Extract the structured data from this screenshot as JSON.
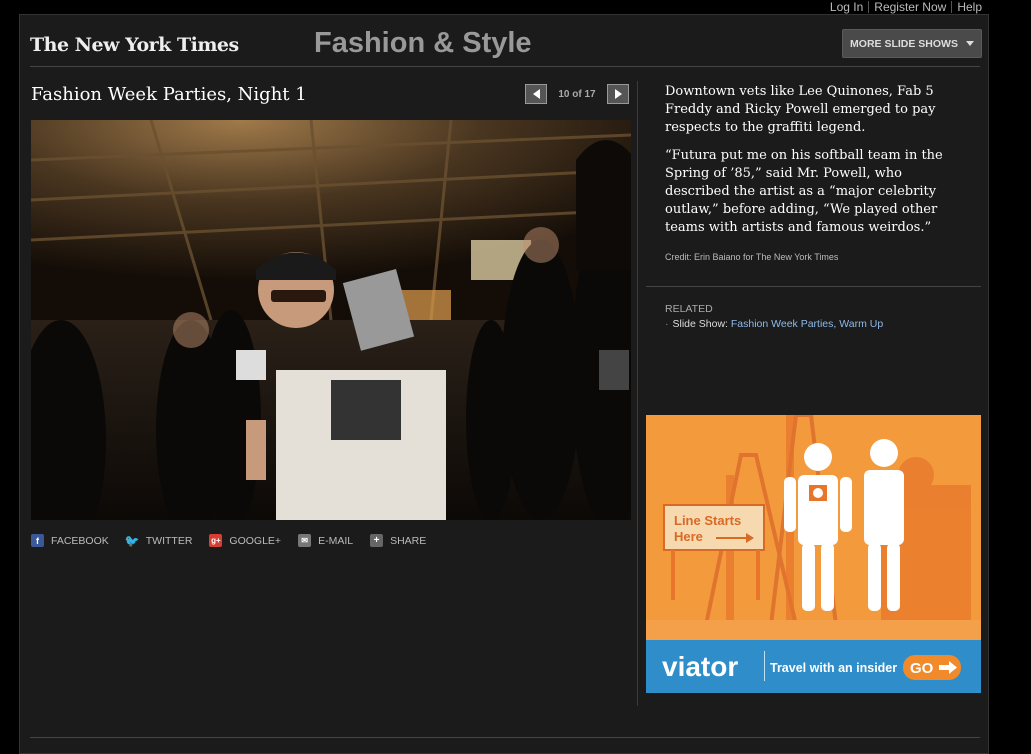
{
  "top_links": {
    "login": "Log In",
    "register": "Register Now",
    "help": "Help"
  },
  "header": {
    "logo": "The New York Times",
    "section": "Fashion & Style",
    "more_slideshows": "MORE SLIDE SHOWS"
  },
  "slide": {
    "title": "Fashion Week Parties, Night 1",
    "counter": "10 of 17"
  },
  "share": {
    "facebook": "FACEBOOK",
    "twitter": "TWITTER",
    "google": "GOOGLE+",
    "email": "E-MAIL",
    "share": "SHARE"
  },
  "caption": {
    "p1": "Downtown vets like Lee Quinones, Fab 5 Freddy and Ricky Powell emerged to pay respects to the graffiti legend.",
    "p2": "“Futura put me on his softball team in the Spring of ’85,” said Mr. Powell, who described the artist as a “major celebrity outlaw,” before adding, “We played other teams with artists and famous weirdos.”",
    "credit": "Credit: Erin Baiano for The New York Times"
  },
  "related": {
    "heading": "RELATED",
    "prefix": "Slide Show:",
    "link": "Fashion Week Parties, Warm Up"
  },
  "ad": {
    "sign_line1": "Line Starts",
    "sign_line2": "Here",
    "brand": "viator",
    "tagline": "Travel with an insider",
    "cta": "GO"
  },
  "colors": {
    "ad_orange": "#f08a2a",
    "ad_blue": "#2f8ec9",
    "link_blue": "#8fb9e8"
  }
}
